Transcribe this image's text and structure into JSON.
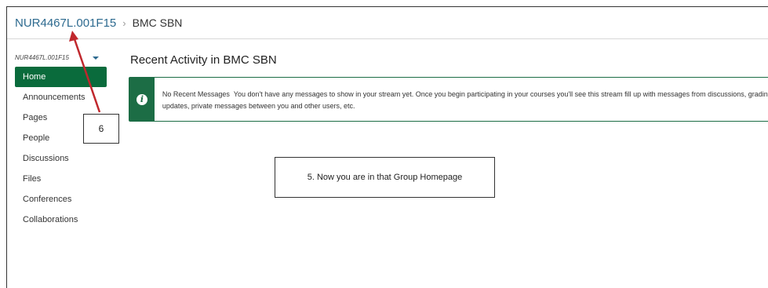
{
  "breadcrumb": {
    "course": "NUR4467L.001F15",
    "separator": "›",
    "group": "BMC SBN"
  },
  "sidebar": {
    "course_select": "NUR4467L.001F15",
    "items": [
      {
        "label": "Home",
        "active": true
      },
      {
        "label": "Announcements"
      },
      {
        "label": "Pages"
      },
      {
        "label": "People"
      },
      {
        "label": "Discussions"
      },
      {
        "label": "Files"
      },
      {
        "label": "Conferences"
      },
      {
        "label": "Collaborations"
      }
    ]
  },
  "main": {
    "title": "Recent Activity in BMC SBN",
    "alert": {
      "icon": "info-icon",
      "heading": "No Recent Messages",
      "text": "You don't have any messages to show in your stream yet. Once you begin participating in your courses you'll see this stream fill up with messages from discussions, grading updates, private messages between you and other users, etc."
    }
  },
  "annotations": {
    "callout_6": "6",
    "callout_5": "5. Now you are in that Group Homepage"
  },
  "colors": {
    "accent_green": "#0a6b3c",
    "link_blue": "#2d6a8f",
    "arrow_red": "#c0282d"
  }
}
